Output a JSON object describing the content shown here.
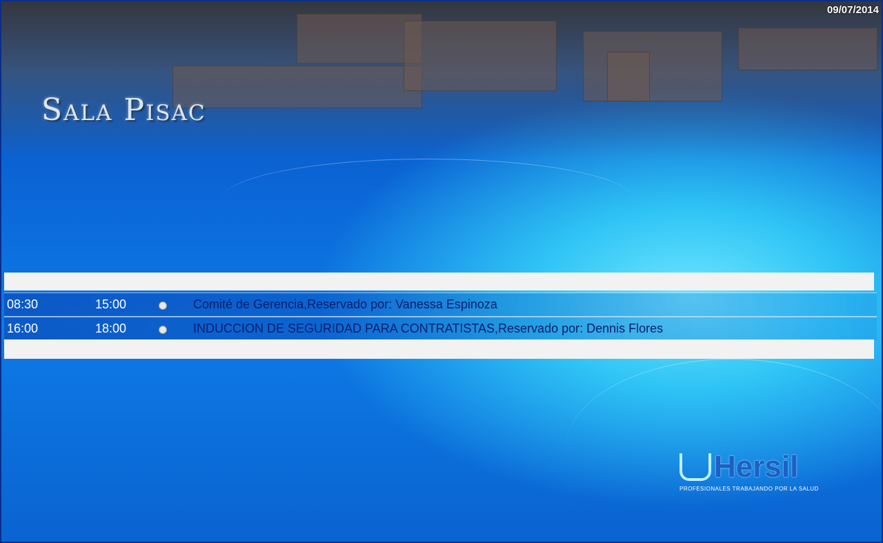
{
  "header": {
    "date": "09/07/2014",
    "room_title": "Sala Pisac"
  },
  "reservations": [
    {
      "start": "08:30",
      "end": "15:00",
      "icon": "clock-icon",
      "description": "Comité de Gerencia,Reservado por: Vanessa Espinoza"
    },
    {
      "start": "16:00",
      "end": "18:00",
      "icon": "clock-icon",
      "description": "INDUCCION DE SEGURIDAD PARA CONTRATISTAS,Reservado por: Dennis Flores"
    }
  ],
  "logo": {
    "brand": "Hersil",
    "tagline": "PROFESIONALES TRABAJANDO POR LA SALUD",
    "icon": "flask-icon"
  },
  "colors": {
    "background": "#0b66d6",
    "accent_light": "#6fe6ff",
    "description_text": "#0a1f6e",
    "time_text": "#ffffff",
    "bar": "#f2f2f2"
  }
}
